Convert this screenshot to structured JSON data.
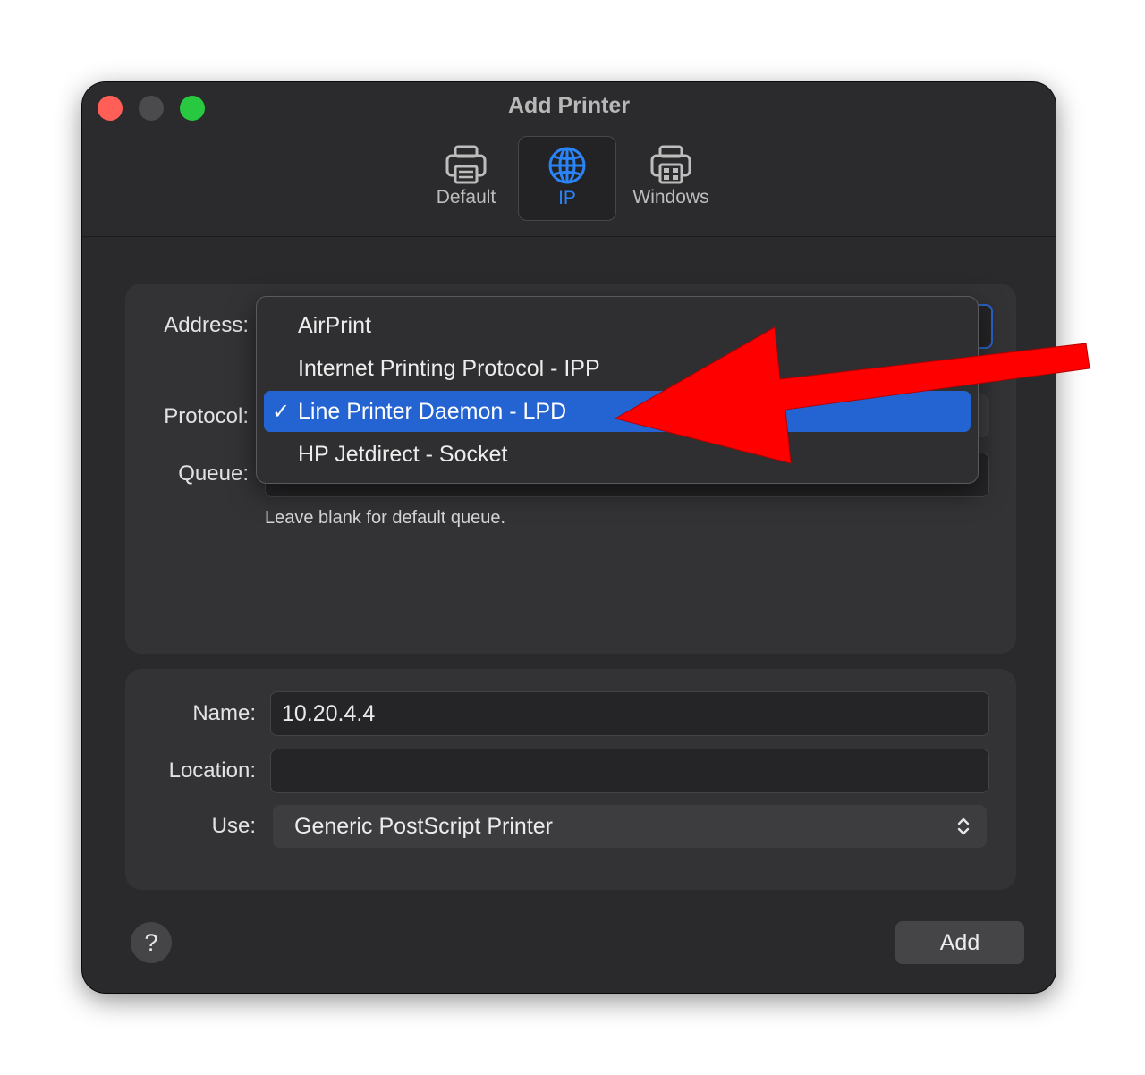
{
  "window": {
    "title": "Add Printer"
  },
  "toolbar": {
    "tabs": [
      {
        "label": "Default"
      },
      {
        "label": "IP"
      },
      {
        "label": "Windows"
      }
    ],
    "selected": "IP"
  },
  "form": {
    "address_label": "Address:",
    "protocol_label": "Protocol:",
    "queue_label": "Queue:",
    "queue_hint": "Leave blank for default queue."
  },
  "protocol_menu": {
    "items": [
      {
        "label": "AirPrint",
        "checked": false
      },
      {
        "label": "Internet Printing Protocol - IPP",
        "checked": false
      },
      {
        "label": "Line Printer Daemon - LPD",
        "checked": true
      },
      {
        "label": "HP Jetdirect - Socket",
        "checked": false
      }
    ],
    "check_glyph": "✓"
  },
  "details": {
    "name_label": "Name:",
    "name_value": "10.20.4.4",
    "location_label": "Location:",
    "location_value": "",
    "use_label": "Use:",
    "use_value": "Generic PostScript Printer"
  },
  "buttons": {
    "help": "?",
    "add": "Add"
  },
  "colors": {
    "accent": "#2a84f7",
    "selection": "#2364d2",
    "annotation_arrow": "#ff0000"
  }
}
